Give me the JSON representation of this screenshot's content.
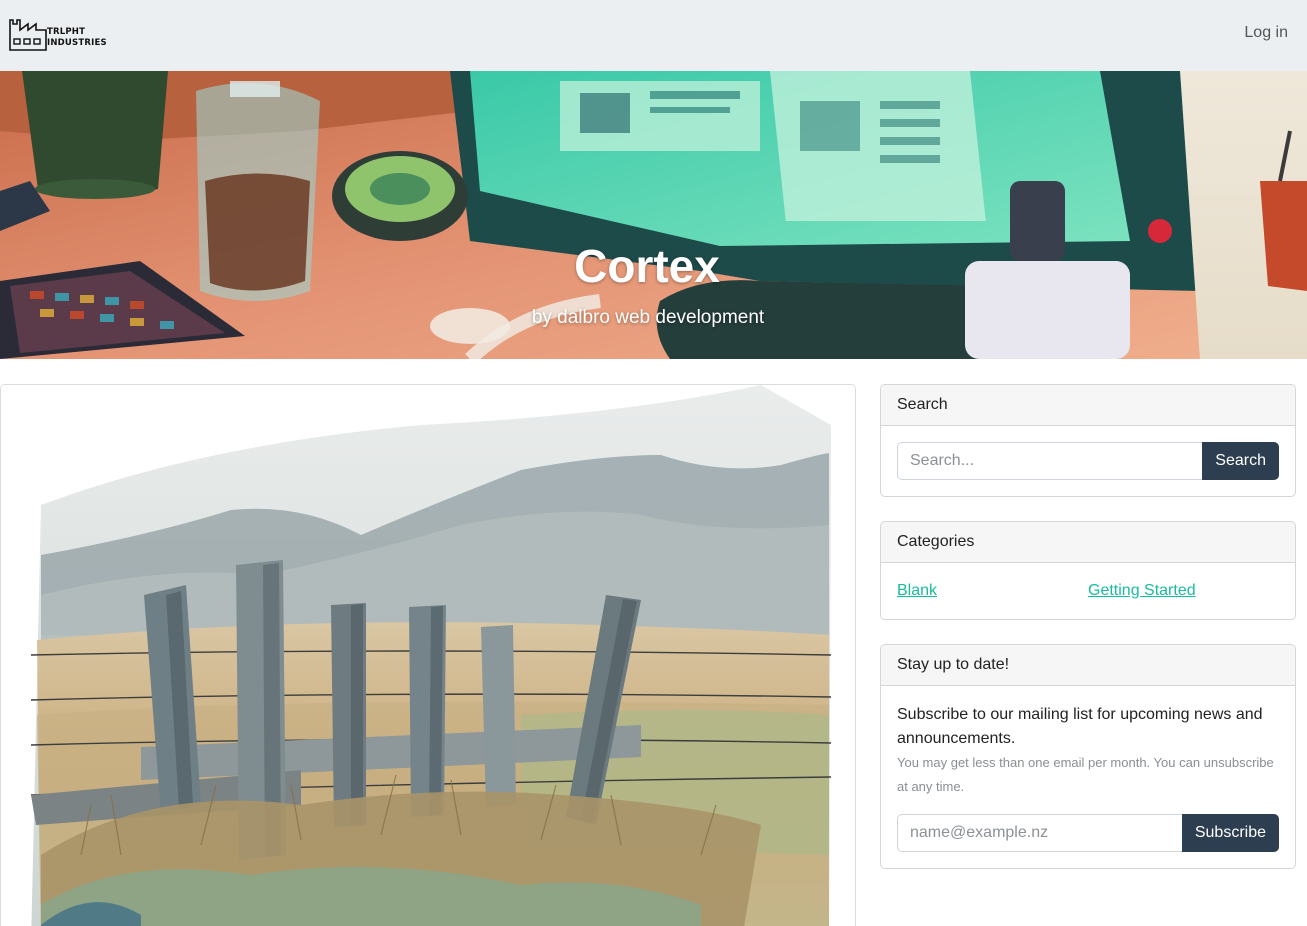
{
  "navbar": {
    "logo": {
      "line1": "TRLPHT",
      "line2": "INDUSTRIES",
      "icon": "factory-icon"
    },
    "login_label": "Log in"
  },
  "hero": {
    "title": "Cortex",
    "subtitle": "by dalbro web development"
  },
  "main": {
    "featured_image": "watercolor-fence-landscape"
  },
  "sidebar": {
    "search": {
      "header": "Search",
      "placeholder": "Search...",
      "button_label": "Search"
    },
    "categories": {
      "header": "Categories",
      "items": [
        {
          "label": "Blank"
        },
        {
          "label": "Getting Started"
        }
      ]
    },
    "newsletter": {
      "header": "Stay up to date!",
      "lead": "Subscribe to our mailing list for upcoming news and announcements.",
      "note": "You may get less than one email per month. You can unsubscribe at any time.",
      "placeholder": "name@example.nz",
      "button_label": "Subscribe"
    }
  },
  "colors": {
    "navbar_bg": "#eceff1",
    "primary_button": "#2c3e50",
    "link": "#18bc9c"
  }
}
